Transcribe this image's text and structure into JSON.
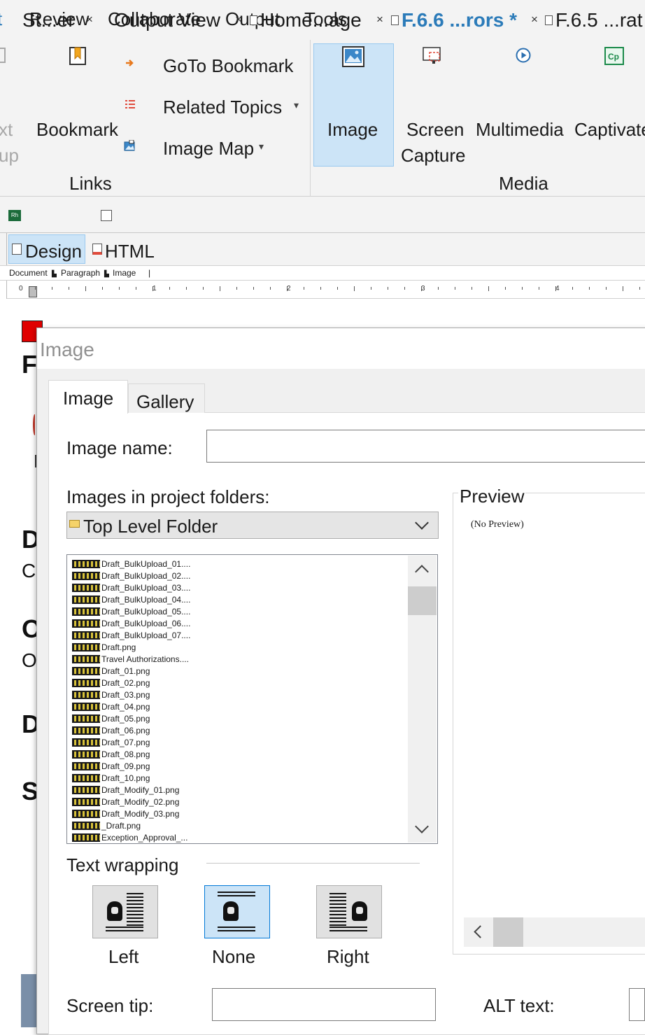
{
  "menu": {
    "prev_fragment": "t",
    "items": [
      "Review",
      "Collaborate",
      "Output",
      "Tools"
    ]
  },
  "ribbon": {
    "faded_fragment_1": "xt",
    "faded_fragment_2": "up",
    "bookmark": "Bookmark",
    "goto_bookmark": "GoTo Bookmark",
    "related_topics": "Related Topics",
    "image_map": "Image Map",
    "links_group": "Links",
    "image": "Image",
    "screen_capture_1": "Screen",
    "screen_capture_2": "Capture",
    "multimedia": "Multimedia",
    "captivate": "Captivate",
    "media_group": "Media"
  },
  "doc_tabs": [
    {
      "label": "St...er",
      "icon": "rh-icon"
    },
    {
      "label": "Output View",
      "icon": "output-view-icon"
    },
    {
      "label": "Home...age",
      "icon": "page-icon"
    },
    {
      "label": "F.6.6 ...rors *",
      "icon": "page-icon",
      "active": true
    },
    {
      "label": "F.6.5 ...rat",
      "icon": "page-icon"
    }
  ],
  "view_tabs": {
    "design": "Design",
    "html": "HTML"
  },
  "breadcrumb": [
    "Document",
    "Paragraph",
    "Image",
    "|"
  ],
  "ruler": [
    "0",
    "1",
    "2",
    "3",
    "4"
  ],
  "editor_peek": {
    "f": "F",
    "d1": "D",
    "c": "C",
    "o1": "O",
    "o2": "O",
    "d2": "D",
    "s": "S"
  },
  "dialog": {
    "title": "Image",
    "tabs": {
      "image": "Image",
      "gallery": "Gallery"
    },
    "image_name_label": "Image name:",
    "image_name_value": "",
    "folders_label": "Images in project folders:",
    "folder_selected": "Top Level Folder",
    "files": [
      "Draft_BulkUpload_01....",
      "Draft_BulkUpload_02....",
      "Draft_BulkUpload_03....",
      "Draft_BulkUpload_04....",
      "Draft_BulkUpload_05....",
      "Draft_BulkUpload_06....",
      "Draft_BulkUpload_07....",
      "Draft.png",
      "Travel Authorizations....",
      "Draft_01.png",
      "Draft_02.png",
      "Draft_03.png",
      "Draft_04.png",
      "Draft_05.png",
      "Draft_06.png",
      "Draft_07.png",
      "Draft_08.png",
      "Draft_09.png",
      "Draft_10.png",
      "Draft_Modify_01.png",
      "Draft_Modify_02.png",
      "Draft_Modify_03.png",
      "_Draft.png",
      "Exception_Approval_..."
    ],
    "preview_label": "Preview",
    "no_preview": "(No Preview)",
    "text_wrapping_label": "Text wrapping",
    "wrap_options": {
      "left": "Left",
      "none": "None",
      "right": "Right"
    },
    "wrap_selected": "None",
    "screen_tip_label": "Screen tip:",
    "alt_text_label": "ALT text:"
  },
  "colors": {
    "accent": "#2b7bb9",
    "selected_bg": "#cce4f7",
    "ribbon_bg": "#f3f3f3"
  }
}
